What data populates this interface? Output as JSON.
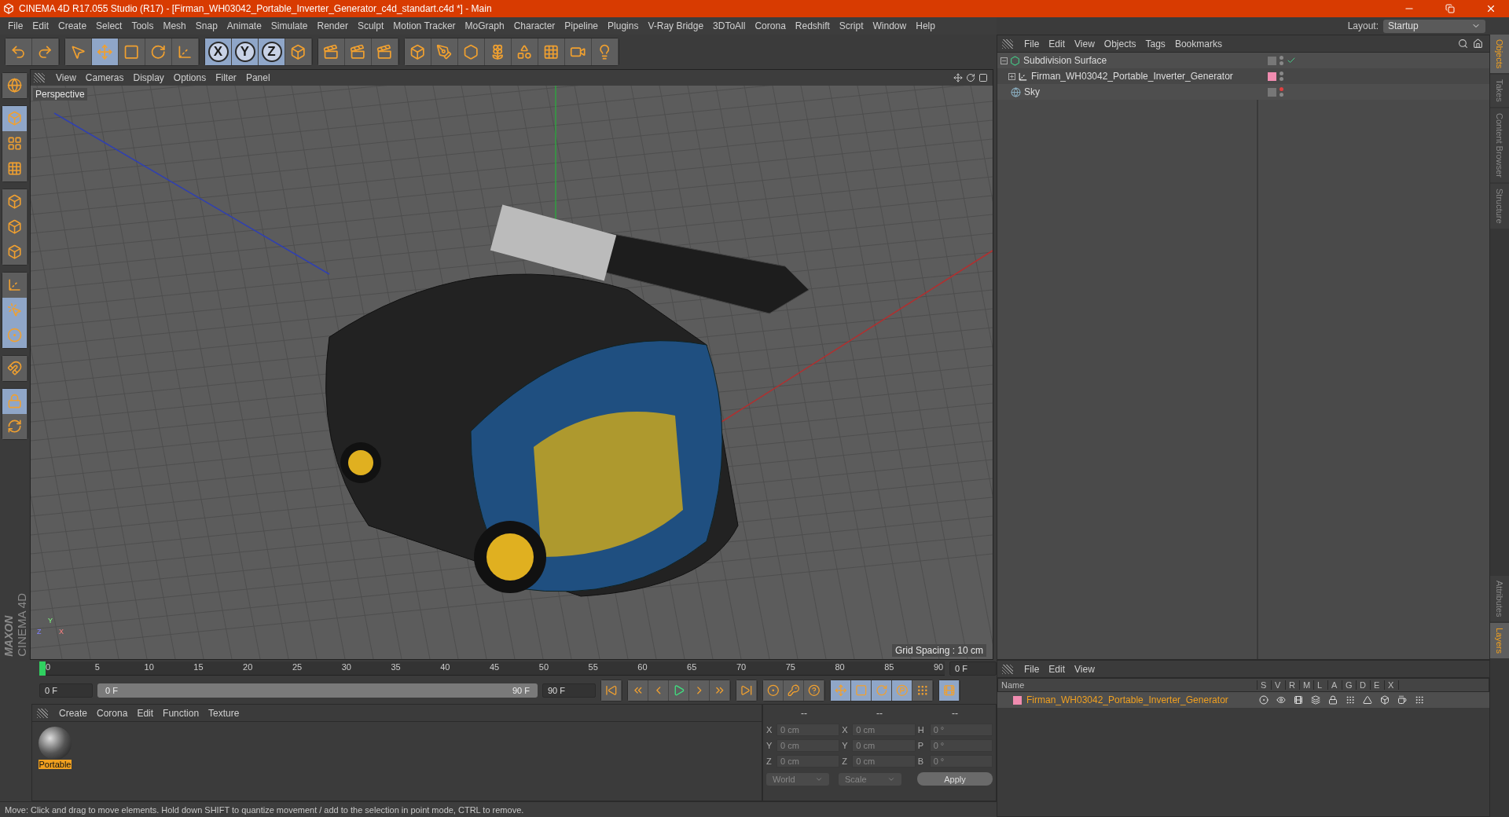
{
  "window": {
    "title": "CINEMA 4D R17.055 Studio (R17) - [Firman_WH03042_Portable_Inverter_Generator_c4d_standart.c4d *] - Main"
  },
  "menu": [
    "File",
    "Edit",
    "Create",
    "Select",
    "Tools",
    "Mesh",
    "Snap",
    "Animate",
    "Simulate",
    "Render",
    "Sculpt",
    "Motion Tracker",
    "MoGraph",
    "Character",
    "Pipeline",
    "Plugins",
    "V-Ray Bridge",
    "3DToAll",
    "Corona",
    "Redshift",
    "Script",
    "Window",
    "Help"
  ],
  "layout": {
    "label": "Layout:",
    "value": "Startup"
  },
  "toolbar": [
    {
      "buttons": [
        {
          "kind": "undo",
          "selected": false
        },
        {
          "kind": "redo",
          "selected": false
        }
      ]
    },
    {
      "buttons": [
        {
          "kind": "select",
          "selected": false
        },
        {
          "kind": "move",
          "selected": true
        },
        {
          "kind": "scale",
          "selected": false
        },
        {
          "kind": "rotate",
          "selected": false
        },
        {
          "kind": "axis",
          "selected": false
        }
      ]
    },
    {
      "buttons": [
        {
          "kind": "letter",
          "label": "X",
          "selected": true
        },
        {
          "kind": "letter",
          "label": "Y",
          "selected": true
        },
        {
          "kind": "letter",
          "label": "Z",
          "selected": true
        },
        {
          "kind": "coords",
          "selected": false
        }
      ]
    },
    {
      "buttons": [
        {
          "kind": "clapper",
          "selected": false
        },
        {
          "kind": "clapper",
          "selected": false
        },
        {
          "kind": "clapper",
          "selected": false
        }
      ]
    },
    {
      "buttons": [
        {
          "kind": "cube",
          "selected": false
        },
        {
          "kind": "pen",
          "selected": false
        },
        {
          "kind": "hexagon",
          "selected": false
        },
        {
          "kind": "flower",
          "selected": false
        },
        {
          "kind": "shape",
          "selected": false
        },
        {
          "kind": "floor",
          "selected": false
        },
        {
          "kind": "camera",
          "selected": false
        },
        {
          "kind": "light",
          "selected": false
        }
      ]
    }
  ],
  "left_tools": [
    {
      "buttons": [
        {
          "kind": "globe",
          "selected": false
        }
      ]
    },
    {
      "buttons": [
        {
          "kind": "cube",
          "selected": true
        },
        {
          "kind": "checker",
          "selected": false
        },
        {
          "kind": "grid",
          "selected": false
        }
      ]
    },
    {
      "buttons": [
        {
          "kind": "points",
          "selected": false
        },
        {
          "kind": "edges",
          "selected": false
        },
        {
          "kind": "polygons",
          "selected": false
        }
      ]
    },
    {
      "buttons": [
        {
          "kind": "axis",
          "selected": false
        },
        {
          "kind": "mouse",
          "selected": true
        },
        {
          "kind": "snap",
          "selected": true
        }
      ]
    },
    {
      "buttons": [
        {
          "kind": "magnet",
          "selected": false
        }
      ]
    },
    {
      "buttons": [
        {
          "kind": "lock",
          "selected": true
        },
        {
          "kind": "sync",
          "selected": false
        }
      ]
    }
  ],
  "logo": {
    "brand": "MAXON",
    "product": "CINEMA 4D"
  },
  "viewport": {
    "menu": [
      "View",
      "Cameras",
      "Display",
      "Options",
      "Filter",
      "Panel"
    ],
    "camera": "Perspective",
    "grid_spacing": "Grid Spacing : 10 cm",
    "axis_labels": [
      "Z",
      "Y",
      "X"
    ]
  },
  "timeline": {
    "ticks": [
      "0",
      "5",
      "10",
      "15",
      "20",
      "25",
      "30",
      "35",
      "40",
      "45",
      "50",
      "55",
      "60",
      "65",
      "70",
      "75",
      "80",
      "85",
      "90"
    ],
    "current": "0 F",
    "start": "0 F",
    "range_start": "0 F",
    "range_end": "90 F",
    "level": 1,
    "end": "90 F"
  },
  "transport": [
    {
      "buttons": [
        {
          "kind": "start",
          "selected": false
        }
      ]
    },
    {
      "buttons": [
        {
          "kind": "prevkey",
          "selected": false
        },
        {
          "kind": "prev",
          "selected": false
        },
        {
          "kind": "play",
          "selected": false
        },
        {
          "kind": "next",
          "selected": false
        },
        {
          "kind": "nextkey",
          "selected": false
        }
      ]
    },
    {
      "buttons": [
        {
          "kind": "end",
          "selected": false
        }
      ]
    },
    {
      "buttons": [
        {
          "kind": "record",
          "selected": false
        },
        {
          "kind": "autokey",
          "selected": false
        },
        {
          "kind": "help",
          "selected": false
        }
      ]
    },
    {
      "buttons": [
        {
          "kind": "move",
          "selected": true
        },
        {
          "kind": "scale",
          "selected": true
        },
        {
          "kind": "rotate",
          "selected": true
        },
        {
          "kind": "param",
          "selected": true
        },
        {
          "kind": "dots",
          "selected": false
        }
      ]
    },
    {
      "buttons": [
        {
          "kind": "film",
          "selected": true
        }
      ]
    }
  ],
  "materials": {
    "menu": [
      "Create",
      "Corona",
      "Edit",
      "Function",
      "Texture"
    ],
    "items": [
      {
        "name": "Portable",
        "selected": true
      }
    ]
  },
  "coordinates": {
    "headers": [
      "--",
      "--",
      "--"
    ],
    "rows": [
      {
        "a": "X",
        "a_value": "0 cm",
        "b": "X",
        "b_value": "0 cm",
        "c": "H",
        "c_value": "0 °"
      },
      {
        "a": "Y",
        "a_value": "0 cm",
        "b": "Y",
        "b_value": "0 cm",
        "c": "P",
        "c_value": "0 °"
      },
      {
        "a": "Z",
        "a_value": "0 cm",
        "b": "Z",
        "b_value": "0 cm",
        "c": "B",
        "c_value": "0 °"
      }
    ],
    "space": "World",
    "mode": "Scale",
    "apply": "Apply"
  },
  "status_bar": "Move: Click and drag to move elements. Hold down SHIFT to quantize movement / add to the selection in point mode, CTRL to remove.",
  "objects": {
    "menu": [
      "File",
      "Edit",
      "View",
      "Objects",
      "Tags",
      "Bookmarks"
    ],
    "items": [
      {
        "name": "Subdivision Surface",
        "kind": "subdivision",
        "expanded": true,
        "checked": true,
        "editor_visible": true,
        "children": [
          {
            "name": "Firman_WH03042_Portable_Inverter_Generator",
            "kind": "null",
            "expanded": false,
            "checked": false,
            "editor_visible": true,
            "color": "#f08cb0"
          }
        ]
      },
      {
        "name": "Sky",
        "kind": "sky",
        "checked": false,
        "editor_visible": false
      }
    ]
  },
  "layers": {
    "menu": [
      "File",
      "Edit",
      "View"
    ],
    "columns": [
      "Name",
      "S",
      "V",
      "R",
      "M",
      "L",
      "A",
      "G",
      "D",
      "E",
      "X"
    ],
    "rows": [
      {
        "name": "Firman_WH03042_Portable_Inverter_Generator",
        "color": "#f08cb0"
      }
    ]
  },
  "side_tabs_top": [
    {
      "label": "Objects",
      "selected": true
    },
    {
      "label": "Takes",
      "selected": false
    },
    {
      "label": "Content Browser",
      "selected": false
    },
    {
      "label": "Structure",
      "selected": false
    }
  ],
  "side_tabs_bottom": [
    {
      "label": "Attributes",
      "selected": false
    },
    {
      "label": "Layers",
      "selected": true
    }
  ]
}
